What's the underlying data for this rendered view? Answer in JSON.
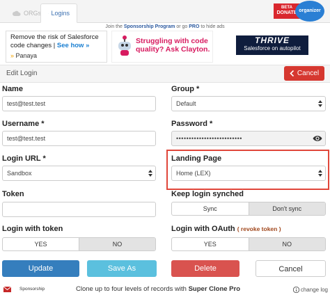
{
  "tabs": [
    {
      "label": "ORGs",
      "active": false
    },
    {
      "label": "Logins",
      "active": true
    }
  ],
  "donate": {
    "beta": "BETA",
    "label": "DONATE"
  },
  "brand": "organizer",
  "promo": {
    "prefix": "Join the",
    "program": "Sponsorship Program",
    "middle": "or go",
    "pro": "PRO",
    "suffix": "to hide ads"
  },
  "ads": {
    "ad1": {
      "text": "Remove the risk of Salesforce code changes |",
      "link": "See how »",
      "brand": "Panaya"
    },
    "ad2": {
      "text": "Struggling with code quality? Ask Clayton."
    },
    "ad3": {
      "brand": "THRIVE",
      "tagline": "Salesforce on autopilot"
    }
  },
  "panel": {
    "title": "Edit Login",
    "cancel_label": "Cancel"
  },
  "fields": {
    "name": {
      "label": "Name",
      "value": "test@test.test"
    },
    "group": {
      "label": "Group *",
      "value": "Default"
    },
    "username": {
      "label": "Username *",
      "value": "test@test.test"
    },
    "password": {
      "label": "Password *",
      "value": "••••••••••••••••••••••••••"
    },
    "login_url": {
      "label": "Login URL *",
      "value": "Sandbox"
    },
    "landing_page": {
      "label": "Landing Page",
      "value": "Home (LEX)"
    },
    "token": {
      "label": "Token",
      "value": ""
    },
    "keep_synched": {
      "label": "Keep login synched",
      "options": [
        "Sync",
        "Don't sync"
      ],
      "selected": "Don't sync"
    },
    "login_with_token": {
      "label": "Login with token",
      "options": [
        "YES",
        "NO"
      ],
      "selected": "NO"
    },
    "login_with_oauth": {
      "label": "Login with OAuth",
      "revoke": "( revoke token )",
      "options": [
        "YES",
        "NO"
      ],
      "selected": "NO"
    }
  },
  "actions": {
    "update": "Update",
    "save_as": "Save As",
    "delete": "Delete",
    "cancel": "Cancel"
  },
  "footer": {
    "sponsorship": "Sponsorship",
    "message_prefix": "Clone up to four levels of records with",
    "message_product": "Super Clone Pro",
    "changelog": "change log"
  },
  "colors": {
    "primary": "#357ebd",
    "info": "#5bc0de",
    "danger": "#d9534f",
    "highlight": "#e0463a"
  }
}
